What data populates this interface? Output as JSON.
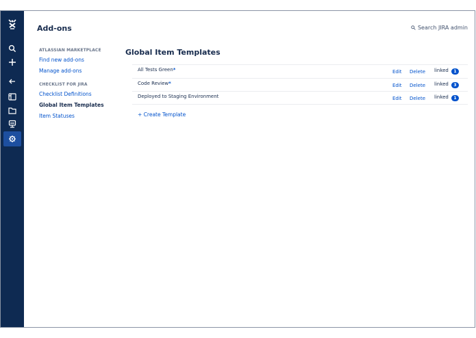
{
  "rail": {
    "items": [
      {
        "name": "app-logo-icon"
      },
      {
        "name": "search-icon"
      },
      {
        "name": "plus-icon"
      },
      {
        "name": "back-arrow-icon"
      },
      {
        "name": "board-icon"
      },
      {
        "name": "folder-icon"
      },
      {
        "name": "monitor-icon"
      },
      {
        "name": "gear-icon",
        "active": true
      }
    ],
    "active_color": "#1d4fa0",
    "bg_color": "#0e2a52"
  },
  "header": {
    "title": "Add-ons",
    "search_label": "Search JIRA admin"
  },
  "sidenav": {
    "section1_heading": "ATLASSIAN MARKETPLACE",
    "section1_items": [
      "Find new add-ons",
      "Manage add-ons"
    ],
    "section2_heading": "CHECKLIST FOR JIRA",
    "section2_items": [
      "Checklist Definitions",
      "Global Item Templates",
      "Item Statuses"
    ],
    "selected": "Global Item Templates"
  },
  "content": {
    "title": "Global Item Templates",
    "rows": [
      {
        "name": "All Tests Green",
        "star": "*",
        "edit": "Edit",
        "delete": "Delete",
        "linked": "linked",
        "count": "1"
      },
      {
        "name": "Code Review",
        "star": "*",
        "edit": "Edit",
        "delete": "Delete",
        "linked": "linked",
        "count": "3"
      },
      {
        "name": "Deployed to Staging Environment",
        "star": "",
        "edit": "Edit",
        "delete": "Delete",
        "linked": "linked",
        "count": "1"
      }
    ],
    "create_label": "+ Create Template"
  },
  "colors": {
    "link": "#0052cc",
    "text": "#172b4d",
    "badge": "#0052cc"
  }
}
